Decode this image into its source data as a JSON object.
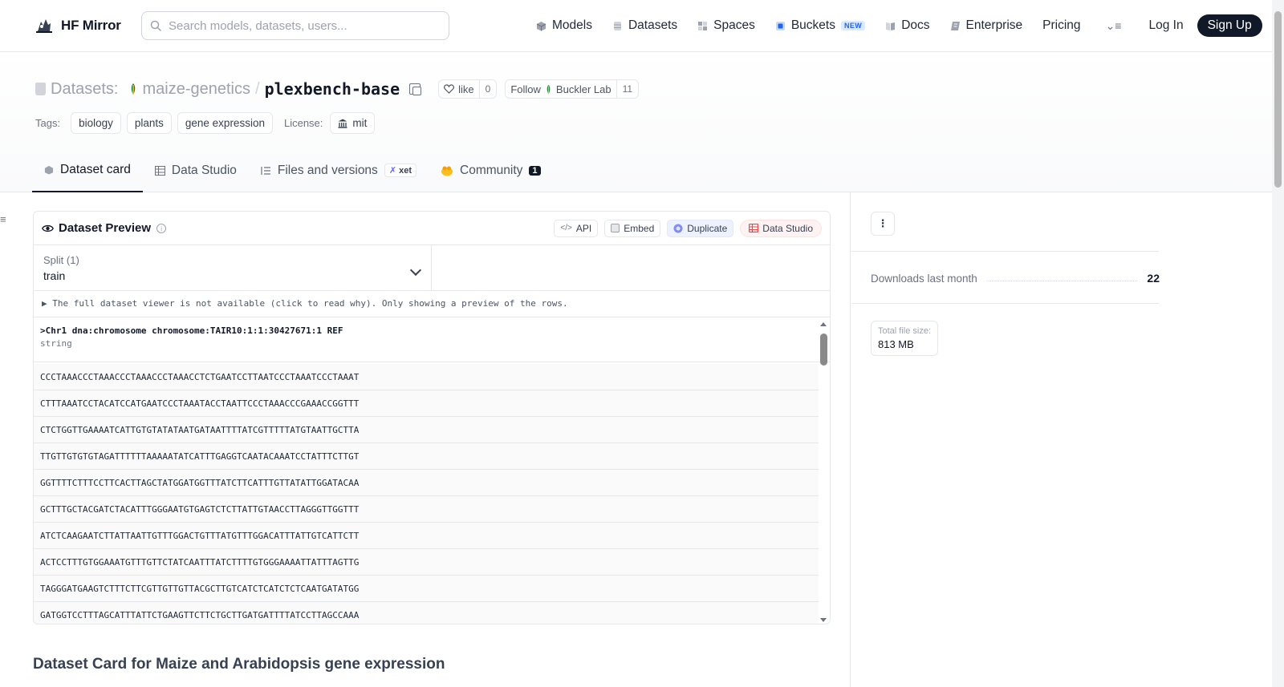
{
  "nav": {
    "logo_text": "HF Mirror",
    "search_placeholder": "Search models, datasets, users...",
    "links": [
      {
        "label": "Models",
        "icon": "models-icon"
      },
      {
        "label": "Datasets",
        "icon": "datasets-icon"
      },
      {
        "label": "Spaces",
        "icon": "spaces-icon"
      },
      {
        "label": "Buckets",
        "icon": "buckets-icon",
        "badge": "NEW"
      },
      {
        "label": "Docs",
        "icon": "docs-icon"
      },
      {
        "label": "Enterprise",
        "icon": "enterprise-icon"
      },
      {
        "label": "Pricing"
      }
    ],
    "login": "Log In",
    "signup": "Sign Up"
  },
  "header": {
    "section": "Datasets:",
    "org": "maize-genetics",
    "separator": "/",
    "repo": "plexbench-base",
    "like_label": "like",
    "like_count": "0",
    "follow_label": "Follow",
    "follow_org": "Buckler Lab",
    "follow_count": "11",
    "tags_label": "Tags:",
    "tags": [
      "biology",
      "plants",
      "gene expression"
    ],
    "license_label": "License:",
    "license": "mit"
  },
  "tabs": [
    {
      "label": "Dataset card",
      "active": true
    },
    {
      "label": "Data Studio"
    },
    {
      "label": "Files and versions",
      "badge": "xet"
    },
    {
      "label": "Community",
      "count": "1"
    }
  ],
  "preview": {
    "title": "Dataset Preview",
    "buttons": {
      "api": "API",
      "embed": "Embed",
      "duplicate": "Duplicate",
      "data_studio": "Data Studio"
    },
    "split_label": "Split (1)",
    "split_value": "train",
    "notice": "▶ The full dataset viewer is not available (click to read why). Only showing a preview of the rows.",
    "column_name": ">Chr1 dna:chromosome chromosome:TAIR10:1:1:30427671:1 REF",
    "column_type": "string",
    "rows": [
      "CCCTAAACCCTAAACCCTAAACCCTAAACCTCTGAATCCTTAATCCCTAAATCCCTAAAT",
      "CTTTAAATCCTACATCCATGAATCCCTAAATACCTAATTCCCTAAACCCGAAACCGGTTT",
      "CTCTGGTTGAAAATCATTGTGTATATAATGATAATTTTATCGTTTTTATGTAATTGCTTA",
      "TTGTTGTGTGTAGATTTTTTAAAAATATCATTTGAGGTCAATACAAATCCTATTTCTTGT",
      "GGTTTTCTTTCCTTCACTTAGCTATGGATGGTTTATCTTCATTTGTTATATTGGATACAA",
      "GCTTTGCTACGATCTACATTTGGGAATGTGAGTCTCTTATTGTAACCTTAGGGTTGGTTT",
      "ATCTCAAGAATCTTATTAATTGTTTGGACTGTTTATGTTTGGACATTTATTGTCATTCTT",
      "ACTCCTTTGTGGAAATGTTTGTTCTATCAATTTATCTTTTGTGGGAAAATTATTTAGTTG",
      "TAGGGATGAAGTCTTTCTTCGTTGTTGTTACGCTTGTCATCTCATCTCTCAATGATATGG",
      "GATGGTCCTTTAGCATTTATTCTGAAGTTCTTCTGCTTGATGATTTTATCCTTAGCCAAA"
    ]
  },
  "card_title": "Dataset Card for Maize and Arabidopsis gene expression",
  "sidebar": {
    "downloads_label": "Downloads last month",
    "downloads_value": "22",
    "filesize_label": "Total file size:",
    "filesize_value": "813 MB"
  },
  "colors": {
    "accent_dark": "#111827",
    "badge_blue": "#2563eb",
    "data_studio_red": "#ef4444"
  }
}
